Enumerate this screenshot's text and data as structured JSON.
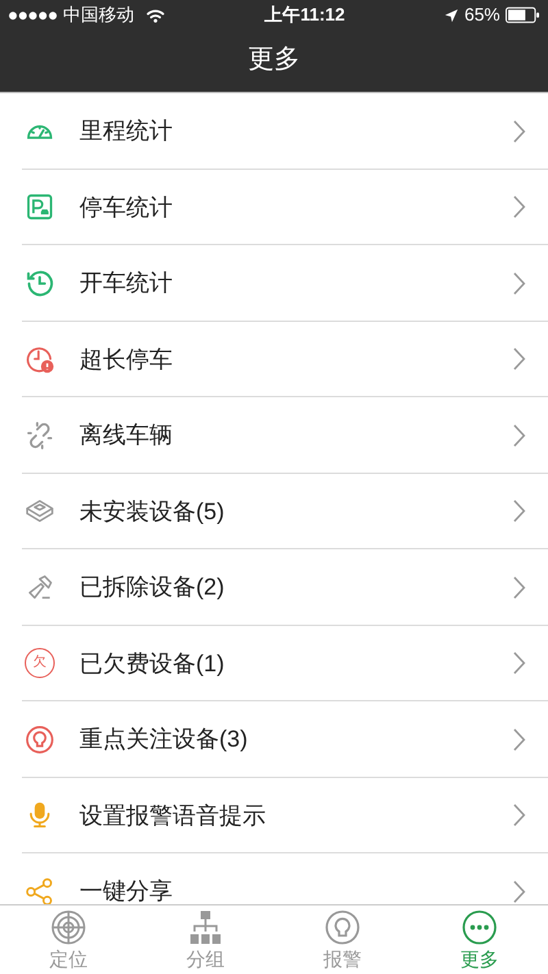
{
  "status_bar": {
    "carrier": "中国移动",
    "time": "上午11:12",
    "battery": "65%"
  },
  "header": {
    "title": "更多"
  },
  "menu": [
    {
      "label": "里程统计",
      "color": "#2bb673"
    },
    {
      "label": "停车统计",
      "color": "#2bb673"
    },
    {
      "label": "开车统计",
      "color": "#2bb673"
    },
    {
      "label": "超长停车",
      "color": "#e8605a"
    },
    {
      "label": "离线车辆",
      "color": "#9a9a9a"
    },
    {
      "label": "未安装设备(5)",
      "color": "#9a9a9a"
    },
    {
      "label": "已拆除设备(2)",
      "color": "#9a9a9a"
    },
    {
      "label": "已欠费设备(1)",
      "color": "#e8605a",
      "icon_text": "欠"
    },
    {
      "label": "重点关注设备(3)",
      "color": "#e8605a"
    },
    {
      "label": "设置报警语音提示",
      "color": "#f0a81e"
    },
    {
      "label": "一键分享",
      "color": "#f0a81e"
    }
  ],
  "tabs": [
    {
      "label": "定位",
      "selected": false
    },
    {
      "label": "分组",
      "selected": false
    },
    {
      "label": "报警",
      "selected": false
    },
    {
      "label": "更多",
      "selected": true
    }
  ]
}
